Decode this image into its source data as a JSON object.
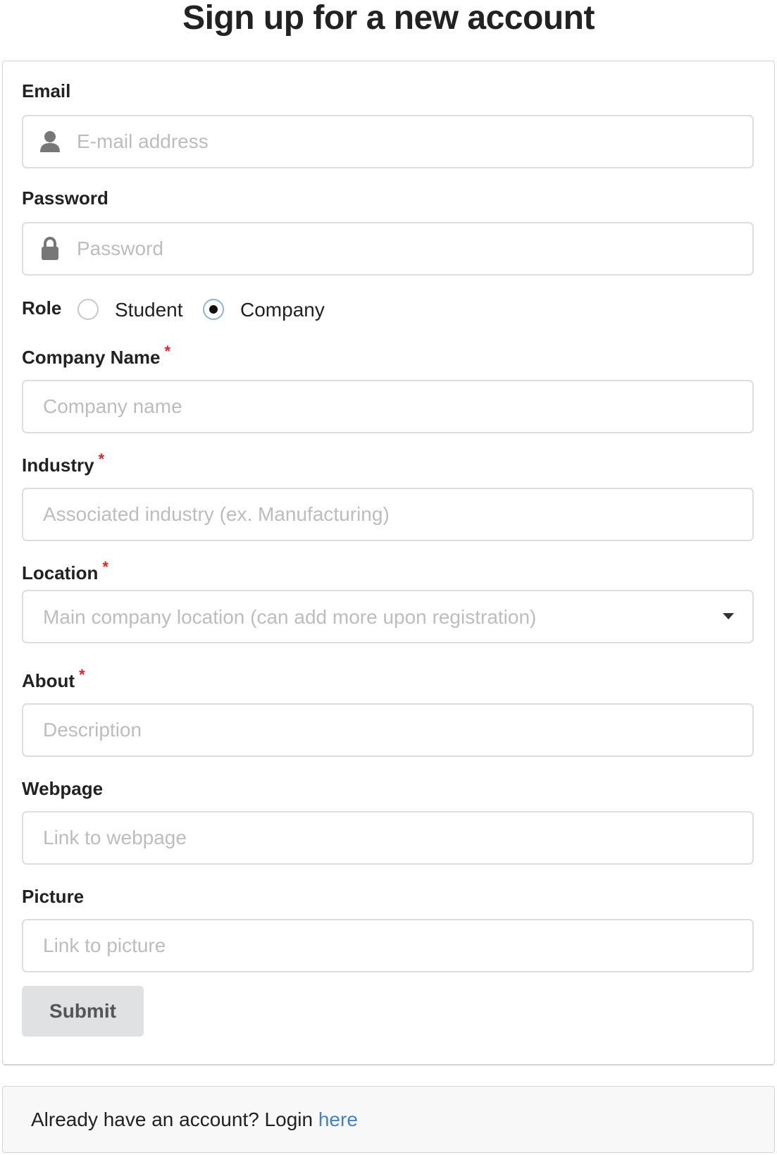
{
  "page": {
    "title": "Sign up for a new account"
  },
  "form": {
    "email": {
      "label": "Email",
      "placeholder": "E-mail address",
      "value": ""
    },
    "password": {
      "label": "Password",
      "placeholder": "Password",
      "value": ""
    },
    "role": {
      "label": "Role",
      "options": [
        "Student",
        "Company"
      ],
      "selected": "Company"
    },
    "company_name": {
      "label": "Company Name",
      "placeholder": "Company name",
      "required_mark": "*"
    },
    "industry": {
      "label": "Industry",
      "placeholder": "Associated industry (ex. Manufacturing)",
      "required_mark": "*"
    },
    "location": {
      "label": "Location",
      "placeholder": "Main company location (can add more upon registration)",
      "required_mark": "*"
    },
    "about": {
      "label": "About",
      "placeholder": "Description",
      "required_mark": "*"
    },
    "webpage": {
      "label": "Webpage",
      "placeholder": "Link to webpage"
    },
    "picture": {
      "label": "Picture",
      "placeholder": "Link to picture"
    },
    "submit_label": "Submit"
  },
  "footer": {
    "prompt": "Already have an account? Login ",
    "link_text": "here"
  },
  "icons": {
    "email_field": "user-icon",
    "password_field": "lock-icon",
    "location_field": "dropdown-caret-icon"
  },
  "colors": {
    "required": "#db2828",
    "link": "#4183c4",
    "button_bg": "#e0e1e2"
  }
}
